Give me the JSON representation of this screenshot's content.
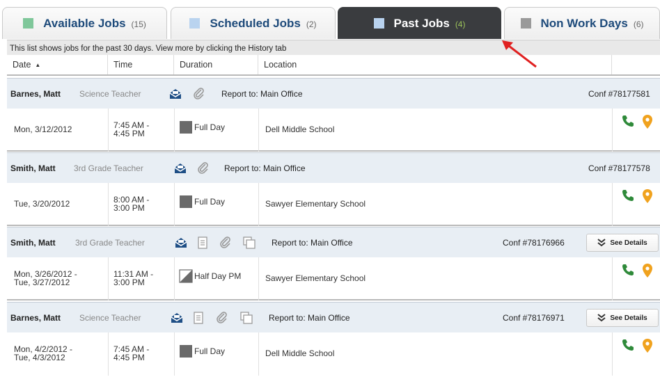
{
  "tabs": [
    {
      "label": "Available Jobs",
      "count": "(15)",
      "swatch": "#7fc79a"
    },
    {
      "label": "Scheduled Jobs",
      "count": "(2)",
      "swatch": "#b9d3ef"
    },
    {
      "label": "Past Jobs",
      "count": "(4)",
      "swatch": "#b9d3ef"
    },
    {
      "label": "Non Work Days",
      "count": "(6)",
      "swatch": "#9a9a9a"
    }
  ],
  "info_text": "This list shows jobs for the past 30 days. View more by clicking the History tab",
  "columns": {
    "date": "Date",
    "time": "Time",
    "duration": "Duration",
    "location": "Location"
  },
  "jobs": [
    {
      "name": "Barnes, Matt",
      "role": "Science Teacher",
      "report": "Report to: Main Office",
      "conf": "Conf #78177581",
      "see_details": "",
      "date_1": "Mon, 3/12/2012",
      "date_2": "",
      "time_1": "7:45 AM -",
      "time_2": "4:45 PM",
      "duration": "Full Day",
      "duration_type": "full",
      "location": "Dell Middle School"
    },
    {
      "name": "Smith, Matt",
      "role": "3rd Grade Teacher",
      "report": "Report to: Main Office",
      "conf": "Conf #78177578",
      "see_details": "",
      "date_1": "Tue, 3/20/2012",
      "date_2": "",
      "time_1": "8:00 AM -",
      "time_2": "3:00 PM",
      "duration": "Full Day",
      "duration_type": "full",
      "location": "Sawyer Elementary School"
    },
    {
      "name": "Smith, Matt",
      "role": "3rd Grade Teacher",
      "report": "Report to: Main Office",
      "conf": "Conf #78176966",
      "see_details": "See Details",
      "date_1": "Mon, 3/26/2012 -",
      "date_2": "Tue, 3/27/2012",
      "time_1": "11:31 AM -",
      "time_2": "3:00 PM",
      "duration": "Half Day PM",
      "duration_type": "half",
      "location": "Sawyer Elementary School"
    },
    {
      "name": "Barnes, Matt",
      "role": "Science Teacher",
      "report": "Report to: Main Office",
      "conf": "Conf #78176971",
      "see_details": "See Details",
      "date_1": "Mon, 4/2/2012 -",
      "date_2": "Tue, 4/3/2012",
      "time_1": "7:45 AM -",
      "time_2": "4:45 PM",
      "duration": "Full Day",
      "duration_type": "full",
      "location": "Dell Middle School"
    }
  ],
  "colors": {
    "accent_blue": "#1d4a7a",
    "phone_green": "#2f8a3a",
    "pin_orange": "#f0a21e",
    "annotation_red": "#e02020"
  },
  "icons": [
    "envelope-icon",
    "attachment-icon",
    "notes-icon",
    "copy-icon",
    "phone-icon",
    "map-pin-icon",
    "chevron-double-down-icon",
    "sort-asc-icon"
  ]
}
